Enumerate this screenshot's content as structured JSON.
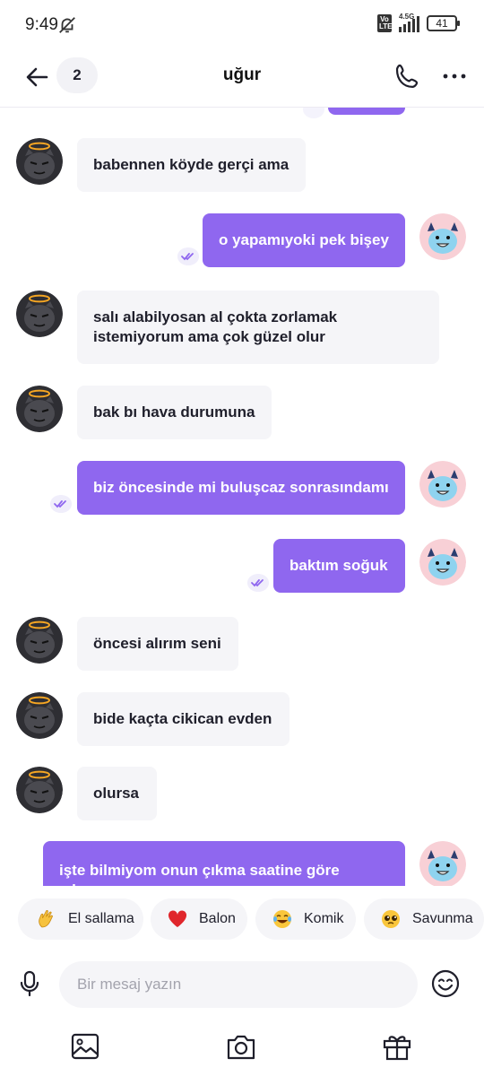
{
  "status_bar": {
    "time": "9:49",
    "network": "4.5G",
    "volte": "Vo LTE",
    "battery": "41"
  },
  "header": {
    "title": "uğur",
    "unread_count": "2"
  },
  "messages": [
    {
      "side": "in",
      "text": "babennen köyde gerçi ama"
    },
    {
      "side": "out",
      "text": "o yapamıyoki pek bişey"
    },
    {
      "side": "in",
      "text": "salı alabilyosan al çokta zorlamak istemiyorum ama çok güzel olur"
    },
    {
      "side": "in",
      "text": "bak bı hava durumuna"
    },
    {
      "side": "out",
      "text": "biz öncesinde mi buluşcaz sonrasındamı"
    },
    {
      "side": "out",
      "text": "baktım soğuk"
    },
    {
      "side": "in",
      "text": "öncesi alırım seni"
    },
    {
      "side": "in",
      "text": "bide kaçta cikican evden"
    },
    {
      "side": "in",
      "text": "olursa"
    },
    {
      "side": "out",
      "text": "işte bilmiyom onun çıkma saatine göre çıkarım"
    }
  ],
  "quick_reactions": [
    {
      "emoji": "waving-hand",
      "label": "El sallama"
    },
    {
      "emoji": "red-heart",
      "label": "Balon"
    },
    {
      "emoji": "tears-of-joy",
      "label": "Komik"
    },
    {
      "emoji": "pleading-face",
      "label": "Savunma"
    }
  ],
  "input": {
    "placeholder": "Bir mesaj yazın"
  },
  "colors": {
    "accent": "#8f67ef",
    "incoming_bubble": "#f5f5f8",
    "text": "#1f1f2b"
  },
  "bottom_actions": [
    "gallery-icon",
    "camera-icon",
    "gift-icon"
  ]
}
